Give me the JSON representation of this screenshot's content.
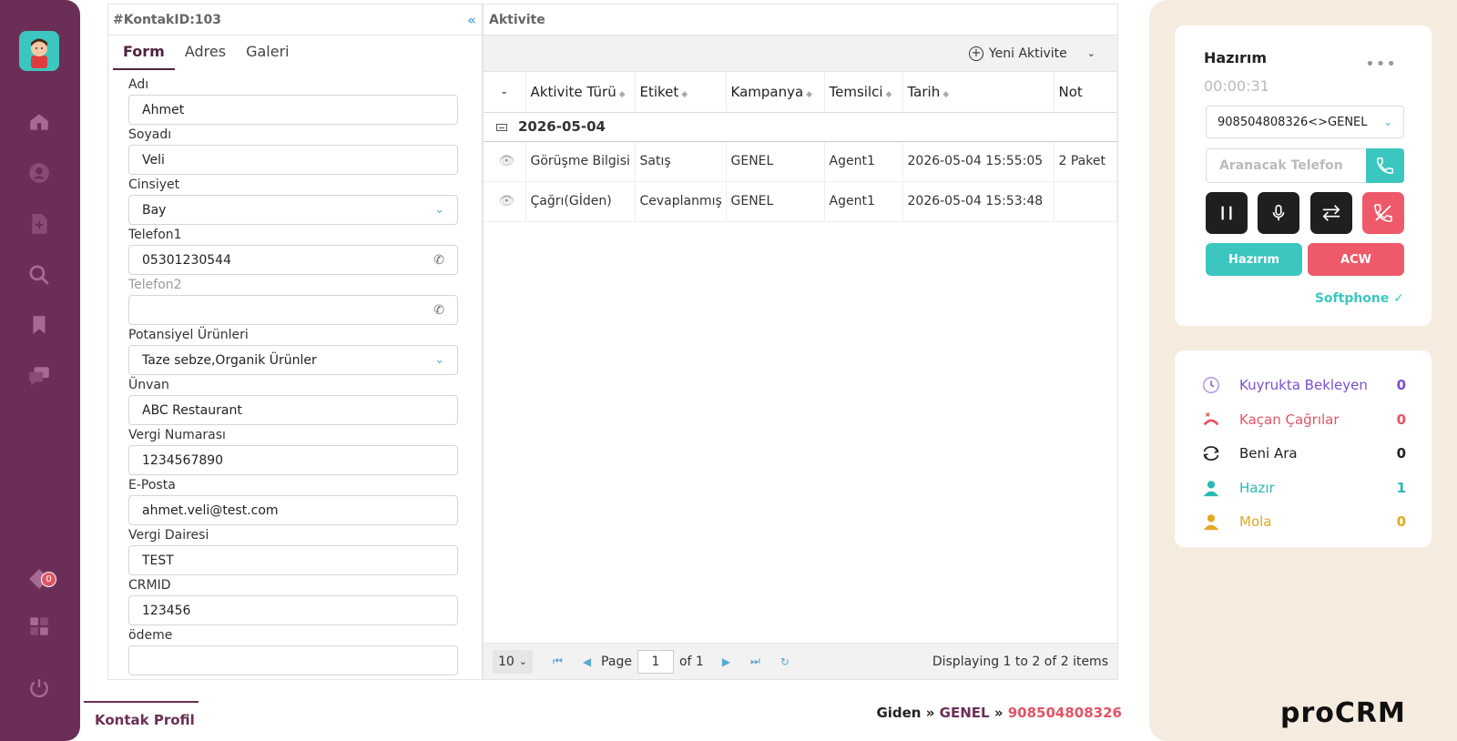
{
  "sidebar": {
    "items": [
      {
        "name": "home"
      },
      {
        "name": "user"
      },
      {
        "name": "add-contact"
      },
      {
        "name": "search"
      },
      {
        "name": "bookmark"
      },
      {
        "name": "chat"
      }
    ],
    "notification_count": "0",
    "bottom_items": [
      {
        "name": "tag"
      },
      {
        "name": "apps"
      },
      {
        "name": "power"
      }
    ]
  },
  "form_panel": {
    "title": "#KontakID:103",
    "tabs": [
      "Form",
      "Adres",
      "Galeri"
    ],
    "fields": [
      {
        "label": "Adı",
        "value": "Ahmet",
        "type": "text"
      },
      {
        "label": "Soyadı",
        "value": "Veli",
        "type": "text"
      },
      {
        "label": "Cinsiyet",
        "value": "Bay",
        "type": "select"
      },
      {
        "label": "Telefon1",
        "value": "05301230544",
        "type": "phone"
      },
      {
        "label": "Telefon2",
        "value": "",
        "type": "phone"
      },
      {
        "label": "Potansiyel Ürünleri",
        "value": "Taze sebze,Organik Ürünler",
        "type": "select"
      },
      {
        "label": "Ünvan",
        "value": "ABC Restaurant",
        "type": "text"
      },
      {
        "label": "Vergi Numarası",
        "value": "1234567890",
        "type": "text"
      },
      {
        "label": "E-Posta",
        "value": "ahmet.veli@test.com",
        "type": "text"
      },
      {
        "label": "Vergi Dairesi",
        "value": "TEST",
        "type": "text"
      },
      {
        "label": "CRMID",
        "value": "123456",
        "type": "text"
      },
      {
        "label": "ödeme",
        "value": "",
        "type": "text"
      }
    ]
  },
  "activity": {
    "title": "Aktivite",
    "new_button": "Yeni Aktivite",
    "columns": [
      "-",
      "Aktivite Türü",
      "Etiket",
      "Kampanya",
      "Temsilci",
      "Tarih",
      "Not"
    ],
    "group": "2026-05-04",
    "rows": [
      {
        "type": "Görüşme Bilgisi",
        "label": "Satış",
        "campaign": "GENEL",
        "agent": "Agent1",
        "date": "2026-05-04 15:55:05",
        "note": "2 Paket"
      },
      {
        "type": "Çağrı(Gİden)",
        "label": "Cevaplanmış",
        "campaign": "GENEL",
        "agent": "Agent1",
        "date": "2026-05-04 15:53:48",
        "note": ""
      }
    ],
    "pager": {
      "page_size": "10",
      "page_label": "Page",
      "page": "1",
      "of_label": "of 1",
      "info": "Displaying 1 to 2 of 2 items"
    }
  },
  "footer": {
    "tab": "Kontak Profil",
    "direction": "Giden",
    "sep": "»",
    "campaign": "GENEL",
    "number": "908504808326"
  },
  "softphone": {
    "status": "Hazırım",
    "timer": "00:00:31",
    "line": "908504808326<>GENEL",
    "dial_placeholder": "Aranacak Telefon",
    "ready_button": "Hazırım",
    "acw_button": "ACW",
    "softphone_label": "Softphone ✓"
  },
  "queue": [
    {
      "label": "Kuyrukta Bekleyen",
      "value": "0",
      "color": "#7a4fd0",
      "icon": "clock-icon"
    },
    {
      "label": "Kaçan Çağrılar",
      "value": "0",
      "color": "#e25563",
      "icon": "missed-call-icon"
    },
    {
      "label": "Beni Ara",
      "value": "0",
      "color": "#222222",
      "icon": "callback-icon"
    },
    {
      "label": "Hazır",
      "value": "1",
      "color": "#2bb8b2",
      "icon": "agent-ready-icon"
    },
    {
      "label": "Mola",
      "value": "0",
      "color": "#e2a822",
      "icon": "agent-break-icon"
    }
  ],
  "brand": {
    "logo": "proCRM"
  },
  "colors": {
    "sidebar": "#6b2f57",
    "teal": "#3cc6c0",
    "red": "#ee5a6a",
    "panel_bg": "#f5ebdf"
  }
}
